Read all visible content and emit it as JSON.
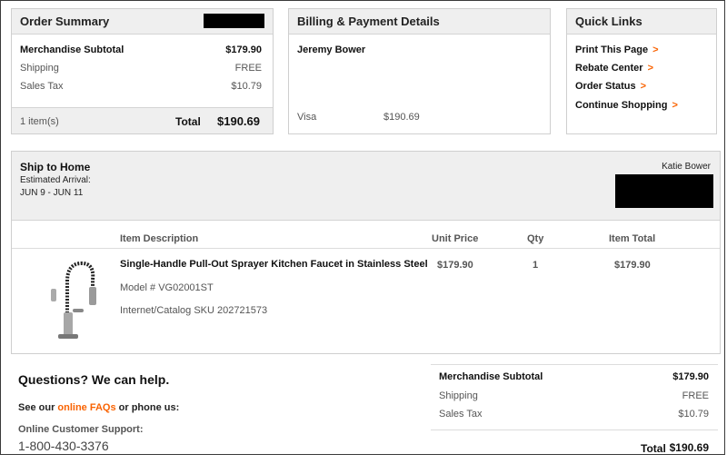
{
  "order_summary": {
    "title": "Order Summary",
    "merch_label": "Merchandise Subtotal",
    "merch_value": "$179.90",
    "shipping_label": "Shipping",
    "shipping_value": "FREE",
    "tax_label": "Sales Tax",
    "tax_value": "$10.79",
    "items_count": "1 item(s)",
    "total_label": "Total",
    "total_value": "$190.69"
  },
  "billing": {
    "title": "Billing & Payment Details",
    "name": "Jeremy Bower",
    "card_type": "Visa",
    "card_amount": "$190.69"
  },
  "quick_links": {
    "title": "Quick Links",
    "items": [
      "Print This Page",
      "Rebate Center",
      "Order Status",
      "Continue Shopping"
    ],
    "chevron": ">"
  },
  "shipment": {
    "title": "Ship to Home",
    "arrival_label": "Estimated Arrival:",
    "arrival_dates": "JUN 9 - JUN 11",
    "recipient": "Katie Bower",
    "columns": [
      "Item Description",
      "Unit Price",
      "Qty",
      "Item Total"
    ],
    "item": {
      "name": "Single-Handle Pull-Out Sprayer Kitchen Faucet in Stainless Steel",
      "model": "Model # VG02001ST",
      "sku": "Internet/Catalog SKU 202721573",
      "unit_price": "$179.90",
      "qty": "1",
      "item_total": "$179.90"
    }
  },
  "help": {
    "title": "Questions? We can help.",
    "see_our": "See our ",
    "faq_link": "online FAQs",
    "or_phone": " or phone us:",
    "support_label": "Online Customer Support:",
    "phone": "1-800-430-3376"
  },
  "bottom_summary": {
    "merch_label": "Merchandise Subtotal",
    "merch_value": "$179.90",
    "shipping_label": "Shipping",
    "shipping_value": "FREE",
    "tax_label": "Sales Tax",
    "tax_value": "$10.79",
    "total_label": "Total",
    "total_value": "$190.69"
  },
  "colors": {
    "accent": "#f96302",
    "panel_header": "#efefef"
  }
}
